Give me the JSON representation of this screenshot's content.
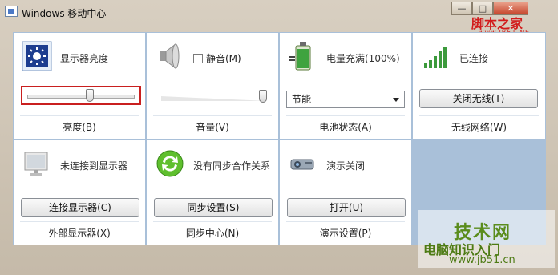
{
  "window": {
    "title": "Windows 移动中心"
  },
  "titlebar_buttons": {
    "minimize": "—",
    "maximize": "□",
    "close": "✕"
  },
  "watermark": {
    "text": "脚本之家",
    "url": "www.JB51.NET"
  },
  "tiles": {
    "brightness": {
      "label": "显示器亮度",
      "footer": "亮度(B)",
      "slider_value_percent": 58,
      "icon": "display-brightness-icon"
    },
    "volume": {
      "mute_label": "静音(M)",
      "muted": false,
      "footer": "音量(V)",
      "slider_value_percent": 100,
      "icon": "speaker-icon"
    },
    "battery": {
      "label": "电量充满(100%)",
      "plan_selected": "节能",
      "footer": "电池状态(A)",
      "icon": "battery-icon"
    },
    "wireless": {
      "label": "已连接",
      "button": "关闭无线(T)",
      "footer": "无线网络(W)",
      "icon": "signal-bars-icon"
    },
    "external_display": {
      "label": "未连接到显示器",
      "button": "连接显示器(C)",
      "footer": "外部显示器(X)",
      "icon": "monitor-icon"
    },
    "sync": {
      "label": "没有同步合作关系",
      "button": "同步设置(S)",
      "footer": "同步中心(N)",
      "icon": "sync-icon"
    },
    "presentation": {
      "label": "演示关闭",
      "button": "打开(U)",
      "footer": "演示设置(P)",
      "icon": "projector-icon"
    }
  },
  "brand_watermark": {
    "main": "技术网",
    "sub": "电脑知识入门",
    "url": "www.jb51.cn"
  },
  "colors": {
    "panel_border": "#a9c0d9",
    "highlight": "#c91f1f",
    "brand_green": "#5a8c1c"
  }
}
